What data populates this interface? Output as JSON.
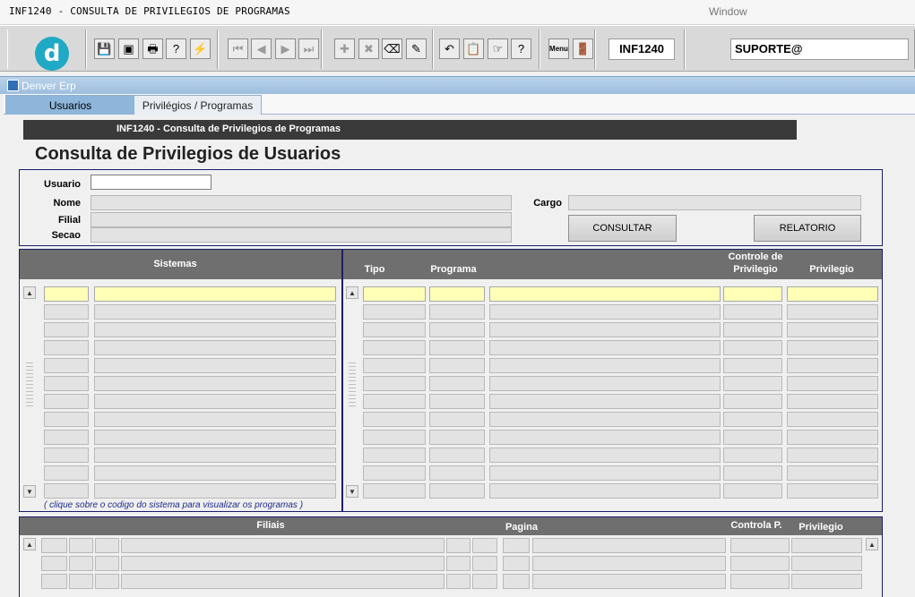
{
  "menubar": {
    "form_title": "INF1240 - CONSULTA DE PRIVILEGIOS DE PROGRAMAS",
    "window_menu": "Window"
  },
  "toolbar": {
    "logo_letter": "d",
    "form_code": "INF1240",
    "user_field": "SUPORTE@",
    "buttons": [
      {
        "name": "save-icon",
        "glyph": "💾",
        "enabled": false
      },
      {
        "name": "window-icon",
        "glyph": "▣",
        "enabled": true
      },
      {
        "name": "print-icon",
        "glyph": "🖶",
        "enabled": true
      },
      {
        "name": "enter-query-icon",
        "glyph": "?",
        "enabled": true
      },
      {
        "name": "execute-query-icon",
        "glyph": "⚡",
        "enabled": true
      },
      {
        "name": "first-record-icon",
        "glyph": "⏮",
        "enabled": false
      },
      {
        "name": "previous-record-icon",
        "glyph": "◀",
        "enabled": false
      },
      {
        "name": "next-record-icon",
        "glyph": "▶",
        "enabled": false
      },
      {
        "name": "last-record-icon",
        "glyph": "⏭",
        "enabled": false
      },
      {
        "name": "insert-record-icon",
        "glyph": "✚",
        "enabled": false
      },
      {
        "name": "delete-record-icon",
        "glyph": "✖",
        "enabled": false
      },
      {
        "name": "clear-record-icon",
        "glyph": "⌫",
        "enabled": true
      },
      {
        "name": "edit-icon",
        "glyph": "✎",
        "enabled": true
      },
      {
        "name": "undo-icon",
        "glyph": "↶",
        "enabled": true
      },
      {
        "name": "clipboard-icon",
        "glyph": "📋",
        "enabled": true
      },
      {
        "name": "hand-icon",
        "glyph": "☞",
        "enabled": true
      },
      {
        "name": "help-icon",
        "glyph": "?",
        "enabled": true
      },
      {
        "name": "menu-icon",
        "glyph": "Menu",
        "enabled": true
      },
      {
        "name": "exit-icon",
        "glyph": "🚪",
        "enabled": true
      }
    ]
  },
  "appbar": {
    "title": "Denver Erp"
  },
  "tabs": [
    {
      "label": "Usuarios",
      "active": true
    },
    {
      "label": "Privilégios / Programas",
      "active": false
    }
  ],
  "form": {
    "header_bar": "INF1240 - Consulta de Privilegios de Programas",
    "heading": "Consulta de Privilegios de Usuarios",
    "labels": {
      "usuario": "Usuario",
      "nome": "Nome",
      "filial": "Filial",
      "secao": "Secao",
      "cargo": "Cargo"
    },
    "values": {
      "usuario": "",
      "nome": "",
      "filial": "",
      "secao": "",
      "cargo": ""
    },
    "buttons": {
      "consultar": "CONSULTAR",
      "relatorio": "RELATORIO"
    }
  },
  "sistemas_grid": {
    "header": "Sistemas",
    "rows": 12,
    "hint": "( clique sobre o codigo do sistema para visualizar os programas )"
  },
  "programas_grid": {
    "headers": {
      "tipo": "Tipo",
      "programa": "Programa",
      "controle_line1": "Controle de",
      "controle_line2": "Privilegio",
      "privilegio": "Privilegio"
    },
    "rows": 12
  },
  "filiais_grid": {
    "headers": {
      "filiais": "Filiais",
      "pagina": "Pagina",
      "controla": "Controla P.",
      "privilegio": "Privilegio"
    },
    "rows": 3
  },
  "colors": {
    "header_bar": "#3a3a3a",
    "grid_head": "#6f6f6f",
    "current_row": "#ffffb8",
    "frame": "#1c1c6c",
    "tab_active": "#8eb5da"
  }
}
